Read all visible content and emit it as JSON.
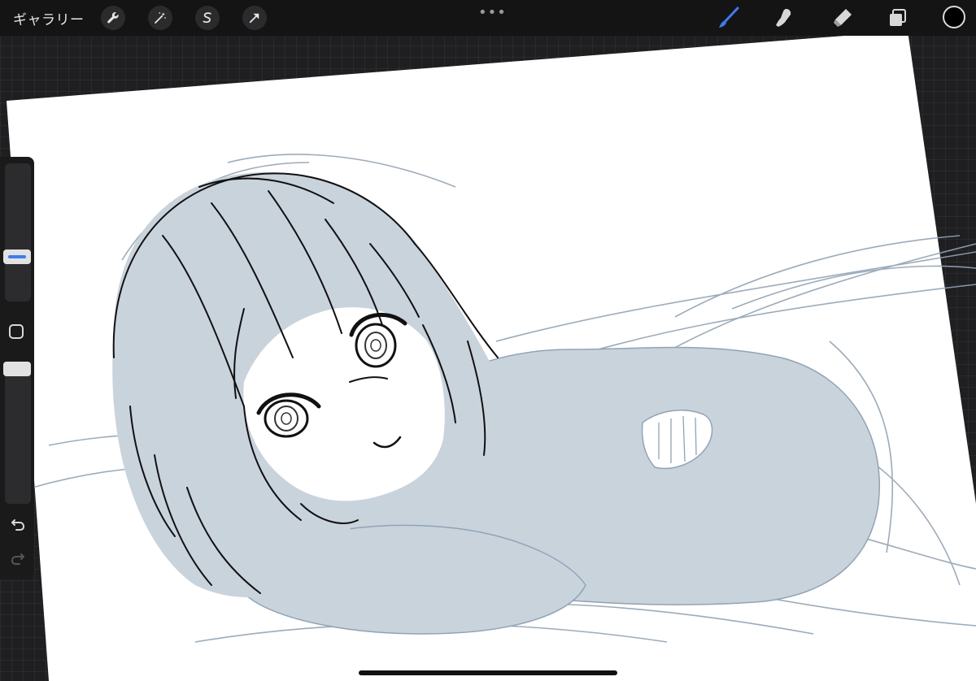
{
  "topbar": {
    "gallery_label": "ギャラリー",
    "left_tools": [
      {
        "name": "actions",
        "icon": "wrench-icon"
      },
      {
        "name": "adjustments",
        "icon": "magic-wand-icon"
      },
      {
        "name": "selection",
        "icon": "selection-s-icon"
      },
      {
        "name": "transform",
        "icon": "arrow-cursor-icon"
      }
    ],
    "more_label": "•••",
    "right_tools": [
      {
        "name": "brush",
        "icon": "brush-icon",
        "active": true
      },
      {
        "name": "smudge",
        "icon": "smudge-icon",
        "active": false
      },
      {
        "name": "eraser",
        "icon": "eraser-icon",
        "active": false
      },
      {
        "name": "layers",
        "icon": "layers-icon",
        "active": false
      }
    ],
    "current_color": "#000000"
  },
  "sidebar": {
    "brush_size_level": 0.3,
    "opacity_level": 1.0
  },
  "colors": {
    "accent": "#3d7bf5",
    "sketch_blue": "#8fa4b8",
    "fill_blue": "#c9d3dc",
    "ink": "#111111"
  }
}
